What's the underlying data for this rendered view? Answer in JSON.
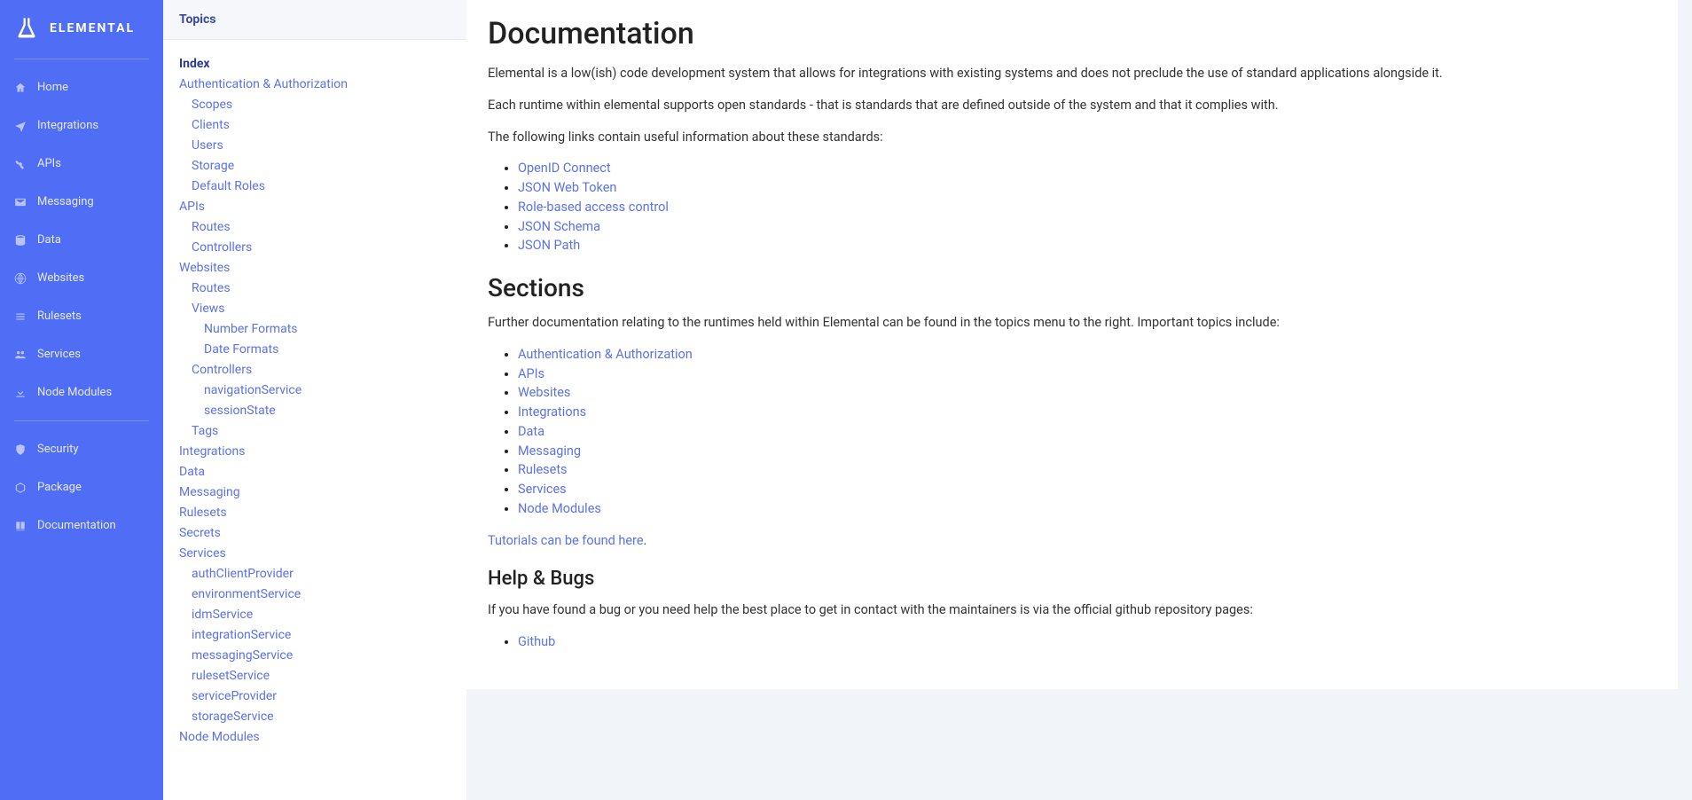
{
  "brand": {
    "name": "ELEMENTAL"
  },
  "nav": [
    {
      "id": "home",
      "label": "Home",
      "icon": "home"
    },
    {
      "id": "integrations",
      "label": "Integrations",
      "icon": "plane"
    },
    {
      "id": "apis",
      "label": "APIs",
      "icon": "satellite"
    },
    {
      "id": "messaging",
      "label": "Messaging",
      "icon": "envelope"
    },
    {
      "id": "data",
      "label": "Data",
      "icon": "database"
    },
    {
      "id": "websites",
      "label": "Websites",
      "icon": "globe"
    },
    {
      "id": "rulesets",
      "label": "Rulesets",
      "icon": "list"
    },
    {
      "id": "services",
      "label": "Services",
      "icon": "users"
    },
    {
      "id": "node-modules",
      "label": "Node Modules",
      "icon": "download"
    },
    {
      "id": "security",
      "label": "Security",
      "icon": "shield"
    },
    {
      "id": "package",
      "label": "Package",
      "icon": "box"
    },
    {
      "id": "documentation",
      "label": "Documentation",
      "icon": "book"
    }
  ],
  "topics": {
    "header": "Topics",
    "items": [
      {
        "label": "Index",
        "indent": 0,
        "active": true
      },
      {
        "label": "Authentication & Authorization",
        "indent": 0
      },
      {
        "label": "Scopes",
        "indent": 1
      },
      {
        "label": "Clients",
        "indent": 1
      },
      {
        "label": "Users",
        "indent": 1
      },
      {
        "label": "Storage",
        "indent": 1
      },
      {
        "label": "Default Roles",
        "indent": 1
      },
      {
        "label": "APIs",
        "indent": 0
      },
      {
        "label": "Routes",
        "indent": 1
      },
      {
        "label": "Controllers",
        "indent": 1
      },
      {
        "label": "Websites",
        "indent": 0
      },
      {
        "label": "Routes",
        "indent": 1
      },
      {
        "label": "Views",
        "indent": 1
      },
      {
        "label": "Number Formats",
        "indent": 2
      },
      {
        "label": "Date Formats",
        "indent": 2
      },
      {
        "label": "Controllers",
        "indent": 1
      },
      {
        "label": "navigationService",
        "indent": 2
      },
      {
        "label": "sessionState",
        "indent": 2
      },
      {
        "label": "Tags",
        "indent": 1
      },
      {
        "label": "Integrations",
        "indent": 0
      },
      {
        "label": "Data",
        "indent": 0
      },
      {
        "label": "Messaging",
        "indent": 0
      },
      {
        "label": "Rulesets",
        "indent": 0
      },
      {
        "label": "Secrets",
        "indent": 0
      },
      {
        "label": "Services",
        "indent": 0
      },
      {
        "label": "authClientProvider",
        "indent": 1
      },
      {
        "label": "environmentService",
        "indent": 1
      },
      {
        "label": "idmService",
        "indent": 1
      },
      {
        "label": "integrationService",
        "indent": 1
      },
      {
        "label": "messagingService",
        "indent": 1
      },
      {
        "label": "rulesetService",
        "indent": 1
      },
      {
        "label": "serviceProvider",
        "indent": 1
      },
      {
        "label": "storageService",
        "indent": 1
      },
      {
        "label": "Node Modules",
        "indent": 0
      }
    ]
  },
  "doc": {
    "title": "Documentation",
    "intro1": "Elemental is a low(ish) code development system that allows for integrations with existing systems and does not preclude the use of standard applications alongside it.",
    "intro2": "Each runtime within elemental supports open standards - that is standards that are defined outside of the system and that it complies with.",
    "intro3": "The following links contain useful information about these standards:",
    "standards": [
      "OpenID Connect",
      "JSON Web Token",
      "Role-based access control",
      "JSON Schema",
      "JSON Path"
    ],
    "sections_heading": "Sections",
    "sections_text": "Further documentation relating to the runtimes held within Elemental can be found in the topics menu to the right. Important topics include:",
    "section_links": [
      "Authentication & Authorization",
      "APIs",
      "Websites",
      "Integrations",
      "Data",
      "Messaging",
      "Rulesets",
      "Services",
      "Node Modules"
    ],
    "tutorials_link": "Tutorials can be found here",
    "tutorials_suffix": ".",
    "help_heading": "Help & Bugs",
    "help_text": "If you have found a bug or you need help the best place to get in contact with the maintainers is via the official github repository pages:",
    "help_links": [
      "Github"
    ]
  }
}
